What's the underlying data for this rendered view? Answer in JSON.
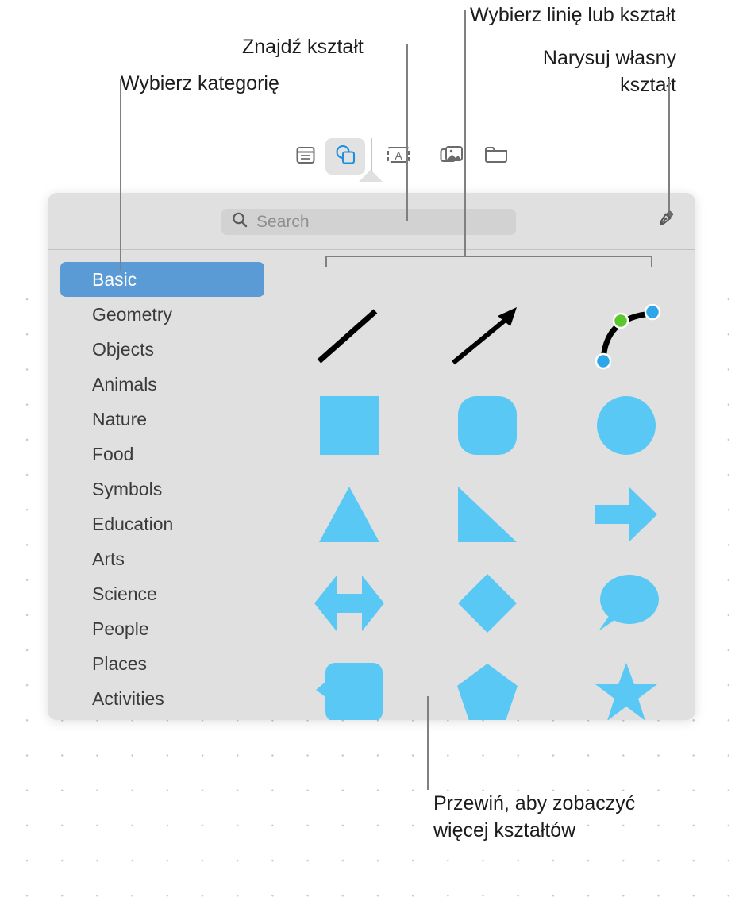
{
  "app": {
    "title": "Shapes library popover"
  },
  "toolbar": {
    "items": [
      {
        "name": "table-icon",
        "label": "Table"
      },
      {
        "name": "shapes-icon",
        "label": "Shape",
        "selected": true
      },
      {
        "name": "text-box-icon",
        "label": "Text"
      },
      {
        "name": "media-icon",
        "label": "Media"
      },
      {
        "name": "folder-icon",
        "label": "Folder"
      }
    ]
  },
  "popover": {
    "search": {
      "placeholder": "Search",
      "value": "",
      "icon": "search-icon"
    },
    "draw_button": {
      "icon": "pen-icon",
      "label": "Draw with Pen"
    },
    "categories": [
      {
        "label": "Basic",
        "selected": true
      },
      {
        "label": "Geometry",
        "selected": false
      },
      {
        "label": "Objects",
        "selected": false
      },
      {
        "label": "Animals",
        "selected": false
      },
      {
        "label": "Nature",
        "selected": false
      },
      {
        "label": "Food",
        "selected": false
      },
      {
        "label": "Symbols",
        "selected": false
      },
      {
        "label": "Education",
        "selected": false
      },
      {
        "label": "Arts",
        "selected": false
      },
      {
        "label": "Science",
        "selected": false
      },
      {
        "label": "People",
        "selected": false
      },
      {
        "label": "Places",
        "selected": false
      },
      {
        "label": "Activities",
        "selected": false
      }
    ],
    "shapes": [
      {
        "name": "line-shape",
        "label": "Line"
      },
      {
        "name": "arrow-line-shape",
        "label": "Arrow"
      },
      {
        "name": "curved-line-shape",
        "label": "Curved line"
      },
      {
        "name": "square-shape",
        "label": "Square"
      },
      {
        "name": "rounded-square-shape",
        "label": "Rounded square"
      },
      {
        "name": "circle-shape",
        "label": "Circle"
      },
      {
        "name": "triangle-shape",
        "label": "Triangle"
      },
      {
        "name": "right-triangle-shape",
        "label": "Right triangle"
      },
      {
        "name": "right-arrow-shape",
        "label": "Right arrow"
      },
      {
        "name": "double-arrow-shape",
        "label": "Double arrow"
      },
      {
        "name": "diamond-shape",
        "label": "Diamond"
      },
      {
        "name": "speech-bubble-shape",
        "label": "Speech bubble"
      },
      {
        "name": "callout-rect-shape",
        "label": "Callout rectangle"
      },
      {
        "name": "pentagon-shape",
        "label": "Pentagon"
      },
      {
        "name": "star-shape",
        "label": "Star"
      }
    ]
  },
  "callouts": {
    "category": "Wybierz kategorię",
    "find_shape": "Znajdź kształt",
    "pick_line_or_shape": "Wybierz linię lub kształt",
    "draw_own_shape": "Narysuj własny\nkształt",
    "scroll_for_more": "Przewiń, aby zobaczyć\nwięcej kształtów"
  },
  "colors": {
    "shape_fill": "#5AC8F5",
    "selection_blue": "#5B9BD5",
    "handle_blue": "#2FA6E8",
    "handle_green": "#5CC62F",
    "popover_bg": "#E0E0E0",
    "leader_gray": "#808080"
  }
}
